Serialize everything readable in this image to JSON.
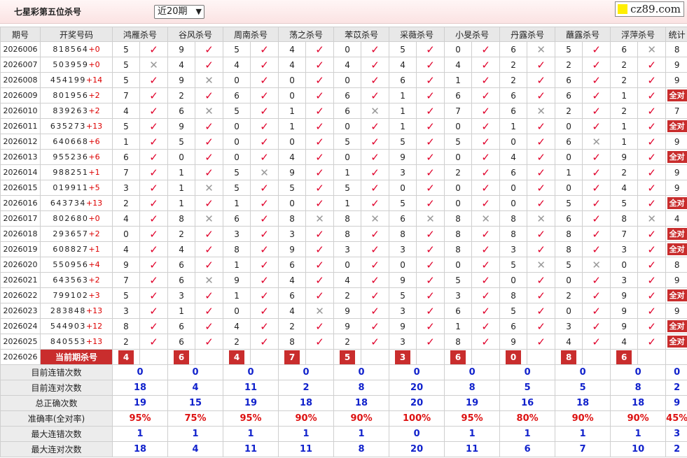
{
  "header": {
    "title": "七星彩第五位杀号",
    "period_select": "近20期",
    "logo_text": "cz89.com"
  },
  "columns": [
    "期号",
    "开奖号码",
    "鸿雁杀号",
    "谷风杀号",
    "周南杀号",
    "荡之杀号",
    "苯苡杀号",
    "采薇杀号",
    "小旻杀号",
    "丹露杀号",
    "蘸露杀号",
    "浮萍杀号",
    "统计"
  ],
  "rows": [
    {
      "id": "2026006",
      "draw": "818564",
      "inc": "+0",
      "kills": [
        [
          "5",
          1
        ],
        [
          "9",
          1
        ],
        [
          "5",
          1
        ],
        [
          "4",
          1
        ],
        [
          "0",
          1
        ],
        [
          "5",
          1
        ],
        [
          "0",
          1
        ],
        [
          "6",
          0
        ],
        [
          "5",
          1
        ],
        [
          "6",
          0
        ]
      ],
      "stat": "8"
    },
    {
      "id": "2026007",
      "draw": "503959",
      "inc": "+0",
      "kills": [
        [
          "5",
          0
        ],
        [
          "4",
          1
        ],
        [
          "4",
          1
        ],
        [
          "4",
          1
        ],
        [
          "4",
          1
        ],
        [
          "4",
          1
        ],
        [
          "4",
          1
        ],
        [
          "2",
          1
        ],
        [
          "2",
          1
        ],
        [
          "2",
          1
        ]
      ],
      "stat": "9"
    },
    {
      "id": "2026008",
      "draw": "454199",
      "inc": "+14",
      "kills": [
        [
          "5",
          1
        ],
        [
          "9",
          0
        ],
        [
          "0",
          1
        ],
        [
          "0",
          1
        ],
        [
          "0",
          1
        ],
        [
          "6",
          1
        ],
        [
          "1",
          1
        ],
        [
          "2",
          1
        ],
        [
          "6",
          1
        ],
        [
          "2",
          1
        ]
      ],
      "stat": "9"
    },
    {
      "id": "2026009",
      "draw": "801956",
      "inc": "+2",
      "kills": [
        [
          "7",
          1
        ],
        [
          "2",
          1
        ],
        [
          "6",
          1
        ],
        [
          "0",
          1
        ],
        [
          "6",
          1
        ],
        [
          "1",
          1
        ],
        [
          "6",
          1
        ],
        [
          "6",
          1
        ],
        [
          "6",
          1
        ],
        [
          "1",
          1
        ]
      ],
      "stat": "全对"
    },
    {
      "id": "2026010",
      "draw": "839263",
      "inc": "+2",
      "kills": [
        [
          "4",
          1
        ],
        [
          "6",
          0
        ],
        [
          "5",
          1
        ],
        [
          "1",
          1
        ],
        [
          "6",
          0
        ],
        [
          "1",
          1
        ],
        [
          "7",
          1
        ],
        [
          "6",
          0
        ],
        [
          "2",
          1
        ],
        [
          "2",
          1
        ]
      ],
      "stat": "7"
    },
    {
      "id": "2026011",
      "draw": "635273",
      "inc": "+13",
      "kills": [
        [
          "5",
          1
        ],
        [
          "9",
          1
        ],
        [
          "0",
          1
        ],
        [
          "1",
          1
        ],
        [
          "0",
          1
        ],
        [
          "1",
          1
        ],
        [
          "0",
          1
        ],
        [
          "1",
          1
        ],
        [
          "0",
          1
        ],
        [
          "1",
          1
        ]
      ],
      "stat": "全对"
    },
    {
      "id": "2026012",
      "draw": "640668",
      "inc": "+6",
      "kills": [
        [
          "1",
          1
        ],
        [
          "5",
          1
        ],
        [
          "0",
          1
        ],
        [
          "0",
          1
        ],
        [
          "5",
          1
        ],
        [
          "5",
          1
        ],
        [
          "5",
          1
        ],
        [
          "0",
          1
        ],
        [
          "6",
          0
        ],
        [
          "1",
          1
        ]
      ],
      "stat": "9"
    },
    {
      "id": "2026013",
      "draw": "955236",
      "inc": "+6",
      "kills": [
        [
          "6",
          1
        ],
        [
          "0",
          1
        ],
        [
          "0",
          1
        ],
        [
          "4",
          1
        ],
        [
          "0",
          1
        ],
        [
          "9",
          1
        ],
        [
          "0",
          1
        ],
        [
          "4",
          1
        ],
        [
          "0",
          1
        ],
        [
          "9",
          1
        ]
      ],
      "stat": "全对"
    },
    {
      "id": "2026014",
      "draw": "988251",
      "inc": "+1",
      "kills": [
        [
          "7",
          1
        ],
        [
          "1",
          1
        ],
        [
          "5",
          0
        ],
        [
          "9",
          1
        ],
        [
          "1",
          1
        ],
        [
          "3",
          1
        ],
        [
          "2",
          1
        ],
        [
          "6",
          1
        ],
        [
          "1",
          1
        ],
        [
          "2",
          1
        ]
      ],
      "stat": "9"
    },
    {
      "id": "2026015",
      "draw": "019911",
      "inc": "+5",
      "kills": [
        [
          "3",
          1
        ],
        [
          "1",
          0
        ],
        [
          "5",
          1
        ],
        [
          "5",
          1
        ],
        [
          "5",
          1
        ],
        [
          "0",
          1
        ],
        [
          "0",
          1
        ],
        [
          "0",
          1
        ],
        [
          "0",
          1
        ],
        [
          "4",
          1
        ]
      ],
      "stat": "9"
    },
    {
      "id": "2026016",
      "draw": "643734",
      "inc": "+13",
      "kills": [
        [
          "2",
          1
        ],
        [
          "1",
          1
        ],
        [
          "1",
          1
        ],
        [
          "0",
          1
        ],
        [
          "1",
          1
        ],
        [
          "5",
          1
        ],
        [
          "0",
          1
        ],
        [
          "0",
          1
        ],
        [
          "5",
          1
        ],
        [
          "5",
          1
        ]
      ],
      "stat": "全对"
    },
    {
      "id": "2026017",
      "draw": "802680",
      "inc": "+0",
      "kills": [
        [
          "4",
          1
        ],
        [
          "8",
          0
        ],
        [
          "6",
          1
        ],
        [
          "8",
          0
        ],
        [
          "8",
          0
        ],
        [
          "6",
          0
        ],
        [
          "8",
          0
        ],
        [
          "8",
          0
        ],
        [
          "6",
          1
        ],
        [
          "8",
          0
        ]
      ],
      "stat": "4"
    },
    {
      "id": "2026018",
      "draw": "293657",
      "inc": "+2",
      "kills": [
        [
          "0",
          1
        ],
        [
          "2",
          1
        ],
        [
          "3",
          1
        ],
        [
          "3",
          1
        ],
        [
          "8",
          1
        ],
        [
          "8",
          1
        ],
        [
          "8",
          1
        ],
        [
          "8",
          1
        ],
        [
          "8",
          1
        ],
        [
          "7",
          1
        ]
      ],
      "stat": "全对"
    },
    {
      "id": "2026019",
      "draw": "608827",
      "inc": "+1",
      "kills": [
        [
          "4",
          1
        ],
        [
          "4",
          1
        ],
        [
          "8",
          1
        ],
        [
          "9",
          1
        ],
        [
          "3",
          1
        ],
        [
          "3",
          1
        ],
        [
          "8",
          1
        ],
        [
          "3",
          1
        ],
        [
          "8",
          1
        ],
        [
          "3",
          1
        ]
      ],
      "stat": "全对"
    },
    {
      "id": "2026020",
      "draw": "550956",
      "inc": "+4",
      "kills": [
        [
          "9",
          1
        ],
        [
          "6",
          1
        ],
        [
          "1",
          1
        ],
        [
          "6",
          1
        ],
        [
          "0",
          1
        ],
        [
          "0",
          1
        ],
        [
          "0",
          1
        ],
        [
          "5",
          0
        ],
        [
          "5",
          0
        ],
        [
          "0",
          1
        ]
      ],
      "stat": "8"
    },
    {
      "id": "2026021",
      "draw": "643563",
      "inc": "+2",
      "kills": [
        [
          "7",
          1
        ],
        [
          "6",
          0
        ],
        [
          "9",
          1
        ],
        [
          "4",
          1
        ],
        [
          "4",
          1
        ],
        [
          "9",
          1
        ],
        [
          "5",
          1
        ],
        [
          "0",
          1
        ],
        [
          "0",
          1
        ],
        [
          "3",
          1
        ]
      ],
      "stat": "9"
    },
    {
      "id": "2026022",
      "draw": "799102",
      "inc": "+3",
      "kills": [
        [
          "5",
          1
        ],
        [
          "3",
          1
        ],
        [
          "1",
          1
        ],
        [
          "6",
          1
        ],
        [
          "2",
          1
        ],
        [
          "5",
          1
        ],
        [
          "3",
          1
        ],
        [
          "8",
          1
        ],
        [
          "2",
          1
        ],
        [
          "9",
          1
        ]
      ],
      "stat": "全对"
    },
    {
      "id": "2026023",
      "draw": "283848",
      "inc": "+13",
      "kills": [
        [
          "3",
          1
        ],
        [
          "1",
          1
        ],
        [
          "0",
          1
        ],
        [
          "4",
          0
        ],
        [
          "9",
          1
        ],
        [
          "3",
          1
        ],
        [
          "6",
          1
        ],
        [
          "5",
          1
        ],
        [
          "0",
          1
        ],
        [
          "9",
          1
        ]
      ],
      "stat": "9"
    },
    {
      "id": "2026024",
      "draw": "544903",
      "inc": "+12",
      "kills": [
        [
          "8",
          1
        ],
        [
          "6",
          1
        ],
        [
          "4",
          1
        ],
        [
          "2",
          1
        ],
        [
          "9",
          1
        ],
        [
          "9",
          1
        ],
        [
          "1",
          1
        ],
        [
          "6",
          1
        ],
        [
          "3",
          1
        ],
        [
          "9",
          1
        ]
      ],
      "stat": "全对"
    },
    {
      "id": "2026025",
      "draw": "840553",
      "inc": "+13",
      "kills": [
        [
          "2",
          1
        ],
        [
          "6",
          1
        ],
        [
          "2",
          1
        ],
        [
          "8",
          1
        ],
        [
          "2",
          1
        ],
        [
          "3",
          1
        ],
        [
          "8",
          1
        ],
        [
          "9",
          1
        ],
        [
          "4",
          1
        ],
        [
          "4",
          1
        ]
      ],
      "stat": "全对"
    }
  ],
  "current": {
    "id": "2026026",
    "label": "当前期杀号",
    "kills": [
      "4",
      "6",
      "4",
      "7",
      "5",
      "3",
      "6",
      "0",
      "8",
      "6"
    ]
  },
  "summary": [
    {
      "label": "目前连错次数",
      "values": [
        "0",
        "0",
        "0",
        "0",
        "0",
        "0",
        "0",
        "0",
        "0",
        "0",
        "0"
      ],
      "rate": false
    },
    {
      "label": "目前连对次数",
      "values": [
        "18",
        "4",
        "11",
        "2",
        "8",
        "20",
        "8",
        "5",
        "5",
        "8",
        "2"
      ],
      "rate": false
    },
    {
      "label": "总正确次数",
      "values": [
        "19",
        "15",
        "19",
        "18",
        "18",
        "20",
        "19",
        "16",
        "18",
        "18",
        "9"
      ],
      "rate": false
    },
    {
      "label": "准确率(全对率)",
      "values": [
        "95%",
        "75%",
        "95%",
        "90%",
        "90%",
        "100%",
        "95%",
        "80%",
        "90%",
        "90%",
        "45%"
      ],
      "rate": true
    },
    {
      "label": "最大连错次数",
      "values": [
        "1",
        "1",
        "1",
        "1",
        "1",
        "0",
        "1",
        "1",
        "1",
        "1",
        "3"
      ],
      "rate": false
    },
    {
      "label": "最大连对次数",
      "values": [
        "18",
        "4",
        "11",
        "11",
        "8",
        "20",
        "11",
        "6",
        "7",
        "10",
        "2"
      ],
      "rate": false
    }
  ],
  "icons": {
    "correct": "check-icon",
    "wrong": "cross-icon"
  },
  "colors": {
    "accent": "#c92d2d",
    "correct": "#e0002a",
    "wrong": "#999999",
    "value": "#1122cc",
    "rate": "#dd1111"
  }
}
